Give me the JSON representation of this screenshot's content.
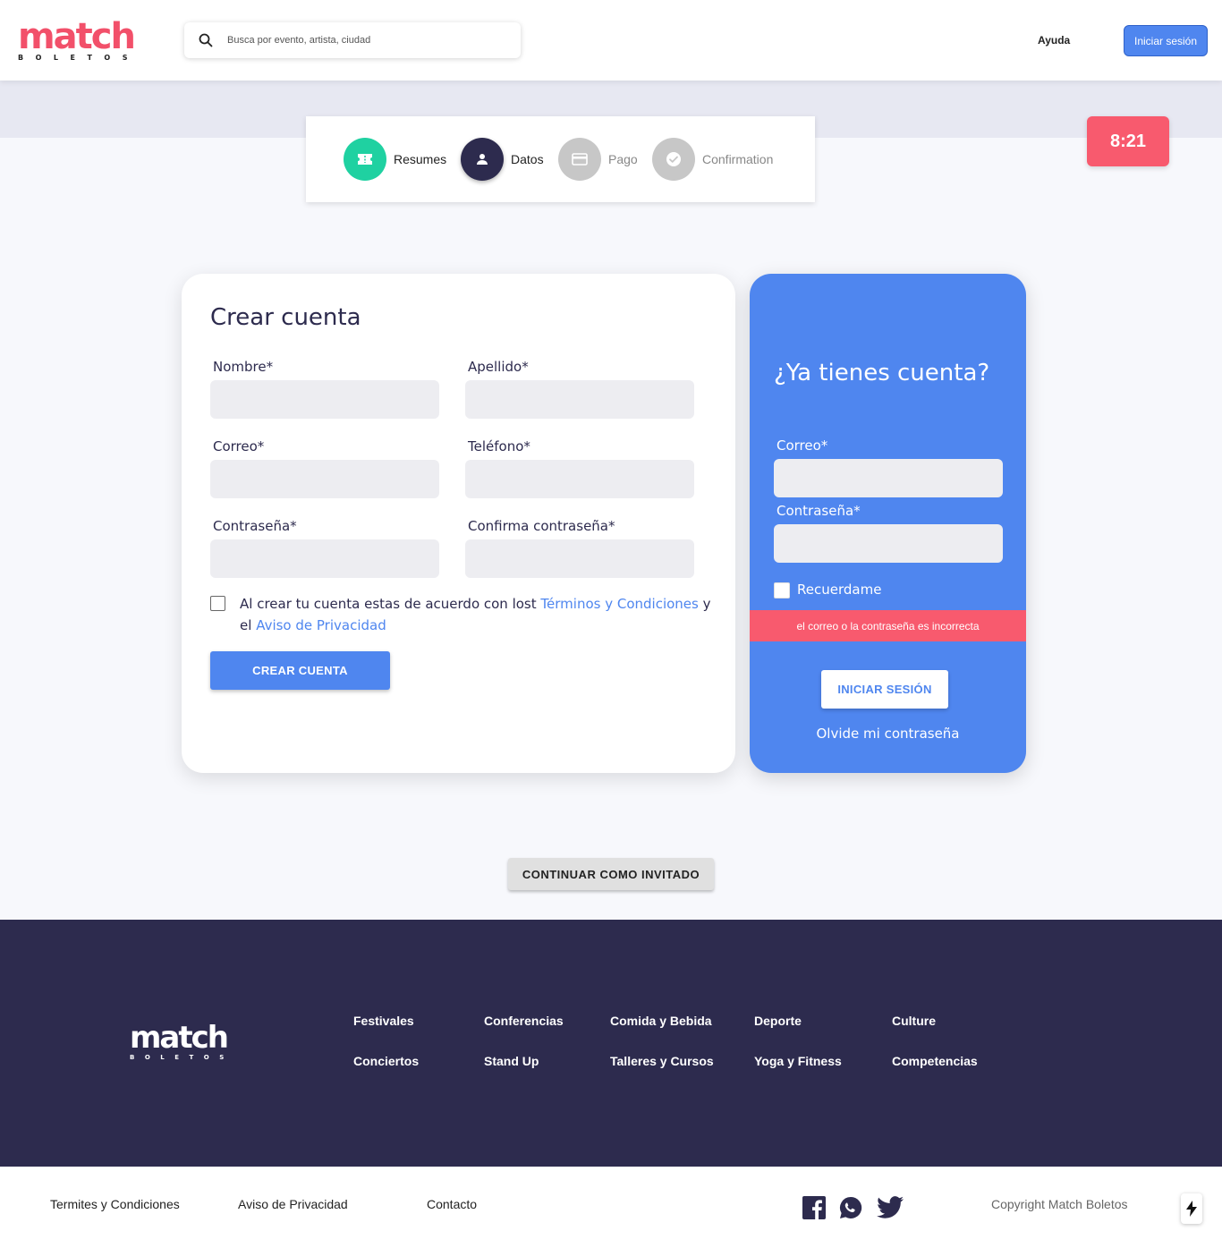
{
  "header": {
    "logo_word": "match",
    "logo_sub": "BOLETOS",
    "search_placeholder": "Busca por evento, artista, ciudad",
    "help_label": "Ayuda",
    "login_label": "Iniciar sesión"
  },
  "stepper": {
    "steps": [
      {
        "label": "Resumes",
        "icon": "ticket-icon",
        "state": "completed"
      },
      {
        "label": "Datos",
        "icon": "user-icon",
        "state": "active"
      },
      {
        "label": "Pago",
        "icon": "credit-card-icon",
        "state": "pending"
      },
      {
        "label": "Confirmation",
        "icon": "check-circle-icon",
        "state": "pending"
      }
    ]
  },
  "timer": "8:21",
  "create_account": {
    "title": "Crear cuenta",
    "fields": {
      "first_name": "Nombre*",
      "last_name": "Apellido*",
      "email": "Correo*",
      "phone": "Teléfono*",
      "password": "Contraseña*",
      "confirm_password": "Confirma contraseña*"
    },
    "terms_prefix": "Al crear tu cuenta estas de acuerdo con lost",
    "terms_link": "Términos y Condiciones",
    "terms_middle": "y el",
    "privacy_link": "Aviso de Privacidad",
    "submit_label": "CREAR CUENTA"
  },
  "login": {
    "title": "¿Ya tienes cuenta?",
    "email_label": "Correo*",
    "password_label": "Contraseña*",
    "remember_label": "Recuerdame",
    "error_message": "el correo o la contraseña es incorrecta",
    "submit_label": "INICIAR SESIÓN",
    "forgot_label": "Olvide mi contraseña"
  },
  "guest_label": "CONTINUAR COMO INVITADO",
  "footer": {
    "logo_word": "match",
    "logo_sub": "BOLETOS",
    "links": [
      "Festivales",
      "Conferencias",
      "Comida y Bebida",
      "Deporte",
      "Culture",
      "Conciertos",
      "Stand Up",
      "Talleres y Cursos",
      "Yoga y Fitness",
      "Competencias"
    ]
  },
  "bottom": {
    "terms": "Termites y Condiciones",
    "privacy": "Aviso de Privacidad",
    "contact": "Contacto",
    "copyright": "Copyright Match Boletos",
    "social_icons": [
      "facebook-icon",
      "whatsapp-icon",
      "twitter-icon"
    ]
  },
  "colors": {
    "brand": "#f2506a",
    "primary": "#4f86ef",
    "navy": "#2d2b4e",
    "success": "#1fd1a1",
    "error": "#f85a6e"
  }
}
